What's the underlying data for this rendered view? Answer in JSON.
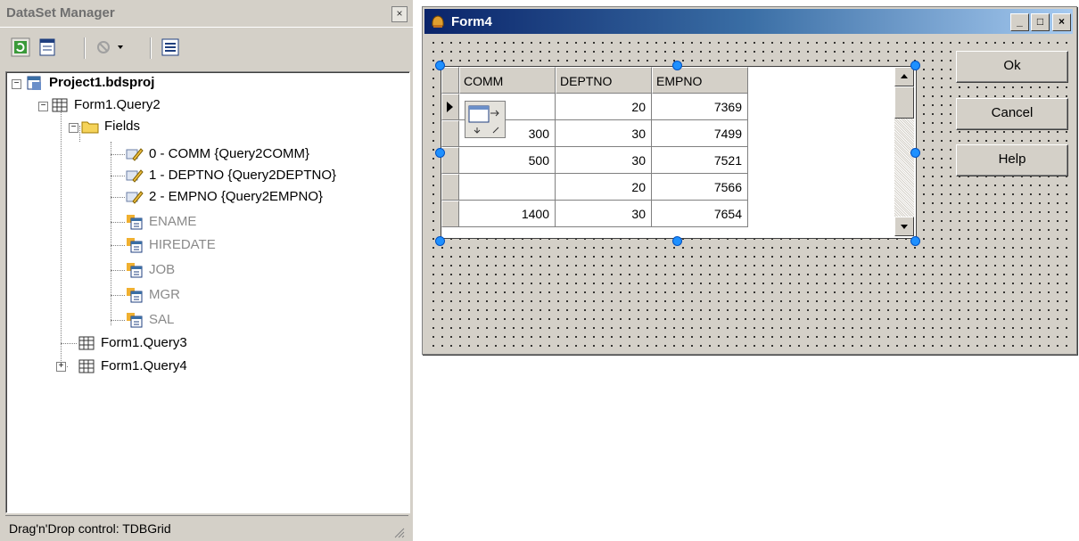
{
  "dataset_manager": {
    "title": "DataSet Manager",
    "close_glyph": "×",
    "toolbar_icons": [
      "refresh-icon",
      "dataset-view-icon",
      "disabled-options-icon",
      "list-view-icon"
    ],
    "tree": {
      "project": "Project1.bdsproj",
      "query2": "Form1.Query2",
      "fields": "Fields",
      "field_items": [
        "0 - COMM {Query2COMM}",
        "1 - DEPTNO {Query2DEPTNO}",
        "2 - EMPNO {Query2EMPNO}"
      ],
      "unadded_fields": [
        "ENAME",
        "HIREDATE",
        "JOB",
        "MGR",
        "SAL"
      ],
      "query3": "Form1.Query3",
      "query4": "Form1.Query4"
    },
    "status": "Drag'n'Drop control: TDBGrid"
  },
  "form": {
    "title": "Form4",
    "grid": {
      "columns": [
        "COMM",
        "DEPTNO",
        "EMPNO"
      ],
      "rows": [
        {
          "comm": "",
          "deptno": "20",
          "empno": "7369"
        },
        {
          "comm": "300",
          "deptno": "30",
          "empno": "7499"
        },
        {
          "comm": "500",
          "deptno": "30",
          "empno": "7521"
        },
        {
          "comm": "",
          "deptno": "20",
          "empno": "7566"
        },
        {
          "comm": "1400",
          "deptno": "30",
          "empno": "7654"
        }
      ]
    },
    "buttons": {
      "ok": "Ok",
      "cancel": "Cancel",
      "help": "Help"
    }
  },
  "colors": {
    "titlebar_start": "#0a246a",
    "titlebar_end": "#a6caf0",
    "face": "#d4d0c8",
    "selection_handle": "#1e90ff"
  }
}
